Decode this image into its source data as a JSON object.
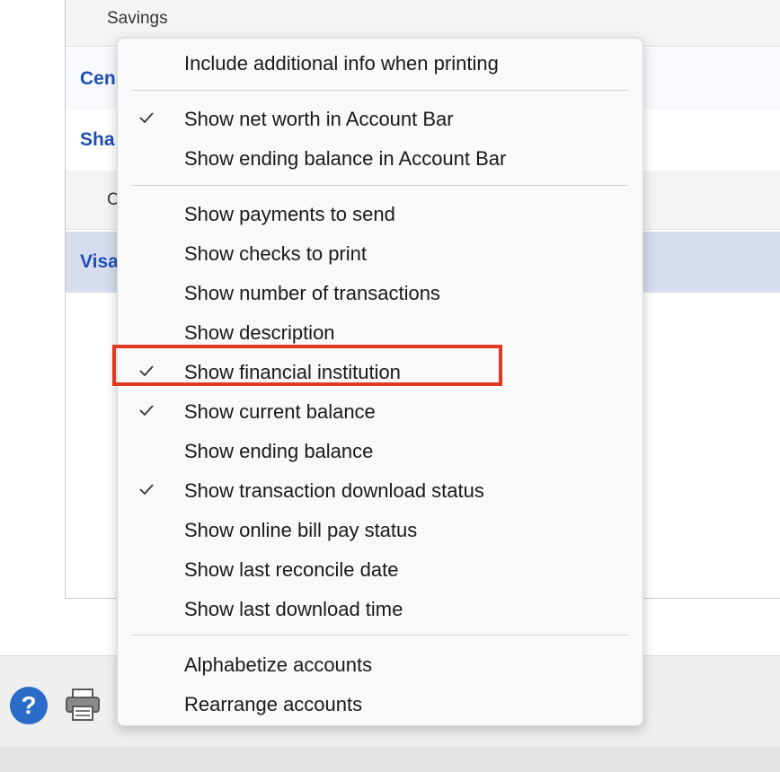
{
  "account_list": {
    "group_savings": "Savings",
    "row_cen": "Cen",
    "row_sha": "Sha",
    "group_c": "C",
    "row_visa": "Visa"
  },
  "menu": {
    "items": [
      {
        "label": "Include additional info when printing",
        "checked": false
      },
      {
        "label": "Show net worth in Account Bar",
        "checked": true
      },
      {
        "label": "Show ending balance in Account Bar",
        "checked": false
      },
      {
        "label": "Show payments to send",
        "checked": false
      },
      {
        "label": "Show checks to print",
        "checked": false
      },
      {
        "label": "Show number of transactions",
        "checked": false
      },
      {
        "label": "Show description",
        "checked": false
      },
      {
        "label": "Show financial institution",
        "checked": true,
        "highlighted": true
      },
      {
        "label": "Show current balance",
        "checked": true
      },
      {
        "label": "Show ending balance",
        "checked": false
      },
      {
        "label": "Show transaction download status",
        "checked": true
      },
      {
        "label": "Show online bill pay status",
        "checked": false
      },
      {
        "label": "Show last reconcile date",
        "checked": false
      },
      {
        "label": "Show last download time",
        "checked": false
      },
      {
        "label": "Alphabetize accounts",
        "checked": false
      },
      {
        "label": "Rearrange accounts",
        "checked": false
      }
    ]
  },
  "footer": {
    "help_glyph": "?",
    "icons": [
      "help-icon",
      "printer-icon"
    ]
  },
  "colors": {
    "highlight": "#e0391f",
    "account_link": "#1f4fb5",
    "selected_row": "#d7ddef",
    "help_icon": "#2a6cc7"
  }
}
